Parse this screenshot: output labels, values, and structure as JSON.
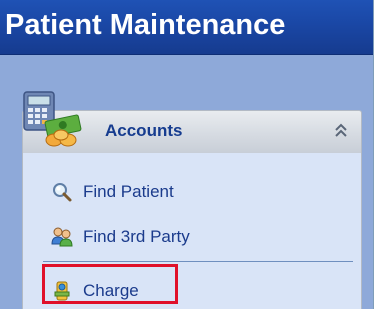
{
  "window": {
    "title": "Patient Maintenance"
  },
  "accounts_panel": {
    "title": "Accounts",
    "icon": "calculator-money-icon",
    "collapse_icon": "double-chevron-up-icon",
    "items": [
      {
        "label": "Find Patient",
        "icon": "magnifier-icon"
      },
      {
        "label": "Find 3rd Party",
        "icon": "people-icon"
      },
      {
        "label": "Charge",
        "icon": "charge-icon"
      }
    ]
  },
  "colors": {
    "title_bar": "#1a47a5",
    "background": "#8ea9d9",
    "panel_body": "#d9e4f7",
    "link_text": "#1b3b8c",
    "highlight": "#e0102a"
  }
}
